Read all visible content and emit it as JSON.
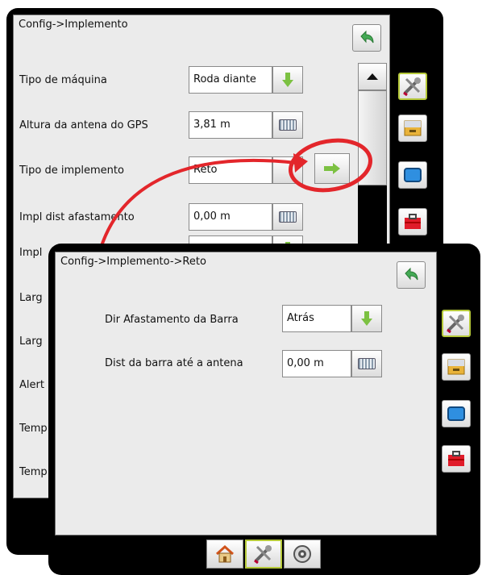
{
  "back_screen": {
    "title": "Config->Implemento",
    "rows": [
      {
        "label": "Tipo de máquina",
        "value": "Roda diante"
      },
      {
        "label": "Altura da antena do GPS",
        "value": "3,81 m"
      },
      {
        "label": "Tipo de implemento",
        "value": "Reto"
      },
      {
        "label": "Impl dist afastamento",
        "value": "0,00 m"
      },
      {
        "label": "Impl",
        "value": ""
      },
      {
        "label": "Larg",
        "value": ""
      },
      {
        "label": "Larg",
        "value": ""
      },
      {
        "label": "Alert",
        "value": ""
      },
      {
        "label": "Temp",
        "value": ""
      },
      {
        "label": "Temp",
        "value": ""
      }
    ]
  },
  "front_screen": {
    "title": "Config->Implemento->Reto",
    "rows": [
      {
        "label": "Dir Afastamento da Barra",
        "value": "Atrás"
      },
      {
        "label": "Dist da barra até a antena",
        "value": "0,00 m"
      }
    ]
  },
  "icons": {
    "back": "back-arrow-icon",
    "tools": "tools-icon",
    "screen": "screen-icon",
    "toolbox": "toolbox-icon",
    "home": "home-icon",
    "settings": "gauge-icon"
  },
  "colors": {
    "green_arrow": "#7cc142",
    "red_circle": "#e3262b",
    "active_border": "#b6c93a"
  }
}
